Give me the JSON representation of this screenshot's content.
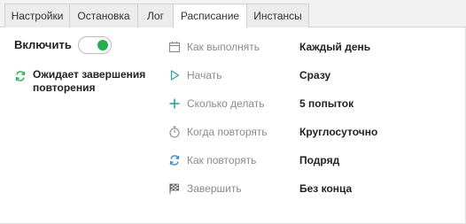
{
  "tabs": [
    {
      "label": "Настройки",
      "active": false
    },
    {
      "label": "Остановка",
      "active": false
    },
    {
      "label": "Лог",
      "active": false
    },
    {
      "label": "Расписание",
      "active": true
    },
    {
      "label": "Инстансы",
      "active": false
    }
  ],
  "enable": {
    "label": "Включить",
    "on": true
  },
  "status": {
    "icon": "repeat-icon",
    "text": "Ожидает завершения повторения"
  },
  "rows": [
    {
      "icon": "calendar-icon",
      "label": "Как выполнять",
      "value": "Каждый день"
    },
    {
      "icon": "play-icon",
      "label": "Начать",
      "value": "Сразу"
    },
    {
      "icon": "plus-icon",
      "label": "Сколько делать",
      "value": "5 попыток"
    },
    {
      "icon": "stopwatch-icon",
      "label": "Когда повторять",
      "value": "Круглосуточно"
    },
    {
      "icon": "repeat-icon",
      "label": "Как повторять",
      "value": "Подряд"
    },
    {
      "icon": "checkered-flag-icon",
      "label": "Завершить",
      "value": "Без конца"
    }
  ],
  "colors": {
    "accent_green": "#22b14c",
    "accent_blue": "#3a8fd6",
    "label_gray": "#8a8a8a"
  }
}
